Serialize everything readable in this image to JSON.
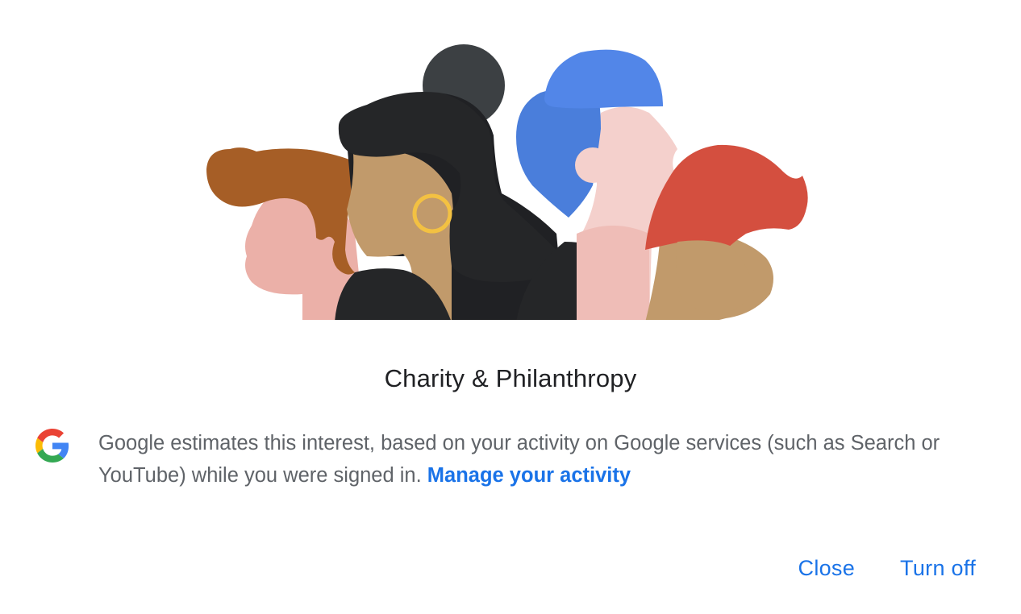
{
  "dialog": {
    "title": "Charity & Philanthropy",
    "info_text": "Google estimates this interest, based on your activity on Google services (such as Search or YouTube) while you were signed in. ",
    "info_link": "Manage your activity",
    "actions": {
      "close_label": "Close",
      "turn_off_label": "Turn off"
    },
    "icons": {
      "logo": "google-g-icon",
      "illustration": "people-profiles-illustration"
    },
    "colors": {
      "accent": "#1a73e8",
      "title": "#202124",
      "body_text": "#5f6368"
    }
  }
}
